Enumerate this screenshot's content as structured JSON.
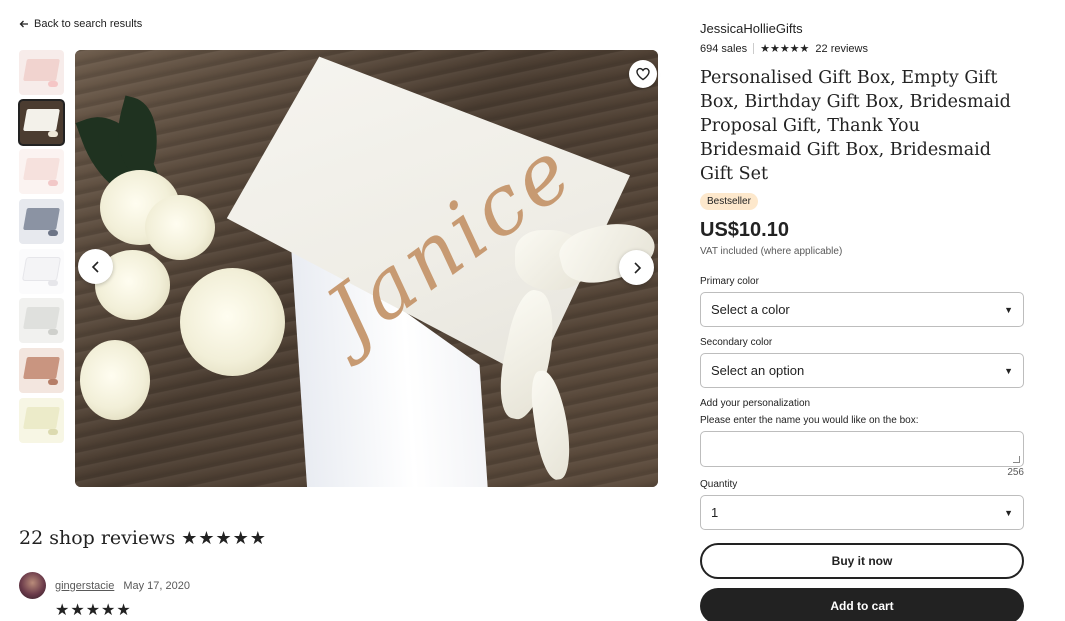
{
  "nav": {
    "back_label": "Back to search results",
    "back_icon": "arrow-left-icon"
  },
  "gallery": {
    "thumbnails": [
      {
        "alt": "pink gift box",
        "lid_color": "#f1d3cf",
        "ribbon_color": "#f5c6c6"
      },
      {
        "alt": "white Janice box",
        "lid_color": "#f3f1ea",
        "ribbon_color": "#efe8d8",
        "active": true
      },
      {
        "alt": "pink bridesmaid box",
        "lid_color": "#f6e1dd",
        "ribbon_color": "#f2c8c8"
      },
      {
        "alt": "grey box",
        "lid_color": "#8b93a3",
        "ribbon_color": "#6c7486"
      },
      {
        "alt": "white box",
        "lid_color": "#f4f4f6",
        "ribbon_color": "#e6e6ea"
      },
      {
        "alt": "silver box",
        "lid_color": "#dfe0dd",
        "ribbon_color": "#cfd0cc"
      },
      {
        "alt": "rose gold box",
        "lid_color": "#c99580",
        "ribbon_color": "#b67e68"
      },
      {
        "alt": "cream box",
        "lid_color": "#ecebc9",
        "ribbon_color": "#dcdab0"
      }
    ],
    "main_image_text": "Janice",
    "favorite_icon": "heart-icon",
    "prev_icon": "chevron-left-icon",
    "next_icon": "chevron-right-icon"
  },
  "reviews": {
    "heading": "22 shop reviews",
    "stars": "★★★★★",
    "first_review": {
      "reviewer": "gingerstacie",
      "date": "May 17, 2020",
      "stars": "★★★★★"
    }
  },
  "listing": {
    "shop_name": "JessicaHollieGifts",
    "sales": "694 sales",
    "rating_stars": "★★★★★",
    "reviews_count": "22 reviews",
    "title": "Personalised Gift Box, Empty Gift Box, Birthday Gift Box, Bridesmaid Proposal Gift, Thank You Bridesmaid Gift Box, Bridesmaid Gift Set",
    "badge": "Bestseller",
    "price": "US$10.10",
    "vat_note": "VAT included (where applicable)",
    "primary_color": {
      "label": "Primary color",
      "value": "Select a color"
    },
    "secondary_color": {
      "label": "Secondary color",
      "value": "Select an option"
    },
    "personalization": {
      "label": "Add your personalization",
      "instructions": "Please enter the name you would like on the box:",
      "value": "",
      "char_count": "256"
    },
    "quantity": {
      "label": "Quantity",
      "value": "1"
    },
    "buy_now_label": "Buy it now",
    "add_to_cart_label": "Add to cart"
  }
}
